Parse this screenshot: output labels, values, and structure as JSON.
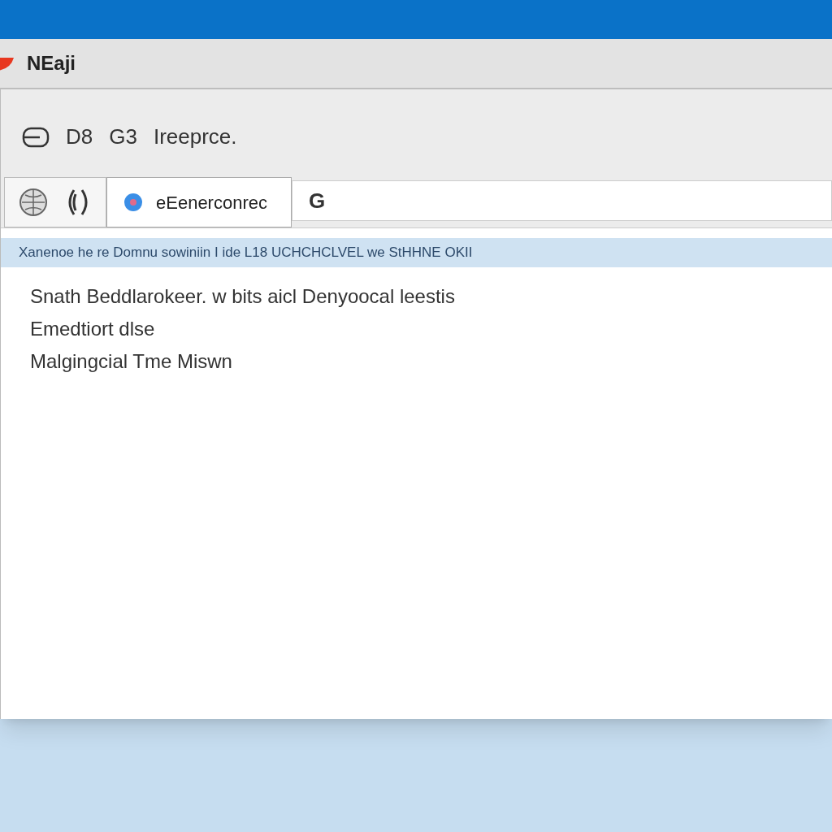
{
  "window": {
    "title": "NEaji"
  },
  "toolbar": {
    "items": [
      "D8",
      "G3",
      "Ireeprce."
    ]
  },
  "tabs": [
    {
      "kind": "icons",
      "selected": false
    },
    {
      "kind": "page",
      "label": "eEenerconrec",
      "selected": true
    }
  ],
  "address_bar": {
    "value": "G"
  },
  "info_bar": {
    "text": "Xanenoe he re Domnu sowiniin I ide L18 UCHCHCLVEL we StHHNE OKII"
  },
  "content": {
    "lines": [
      "Snath Beddlarokeer. w bits aicl Denyoocal leestis",
      "Emedtiort dlse",
      "Malgingcial Tme Miswn"
    ]
  }
}
